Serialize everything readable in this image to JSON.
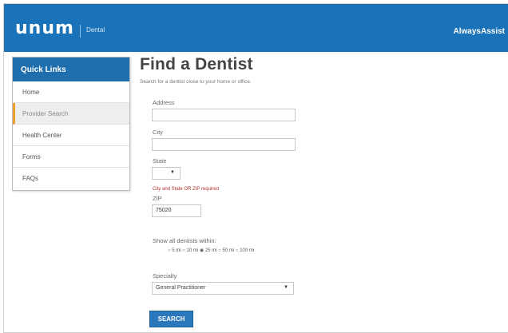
{
  "header": {
    "logo": "unum",
    "product": "Dental",
    "right_label": "AlwaysAssist"
  },
  "quick_links": {
    "title": "Quick Links",
    "items": [
      {
        "label": "Home",
        "active": false
      },
      {
        "label": "Provider Search",
        "active": true
      },
      {
        "label": "Health Center",
        "active": false
      },
      {
        "label": "Forms",
        "active": false
      },
      {
        "label": "FAQs",
        "active": false
      }
    ]
  },
  "main": {
    "title": "Find a Dentist",
    "description": "Search for a dentist close to your home or office.",
    "address_label": "Address",
    "address_value": "",
    "city_label": "City",
    "city_value": "",
    "state_label": "State",
    "state_value": "",
    "error": "City and State OR ZIP required",
    "zip_label": "ZIP",
    "zip_value": "75020",
    "radius_label": "Show all dentists within:",
    "radius_options": "○ 5 mi ○ 10 mi ◉ 25 mi ○ 50 mi ○ 100 mi",
    "specialty_label": "Specialty",
    "specialty_value": "General Practitioner",
    "search_button": "SEARCH"
  },
  "colors": {
    "brand_blue": "#1a73b8",
    "active_accent": "#f0a030",
    "error_red": "#b03030"
  }
}
